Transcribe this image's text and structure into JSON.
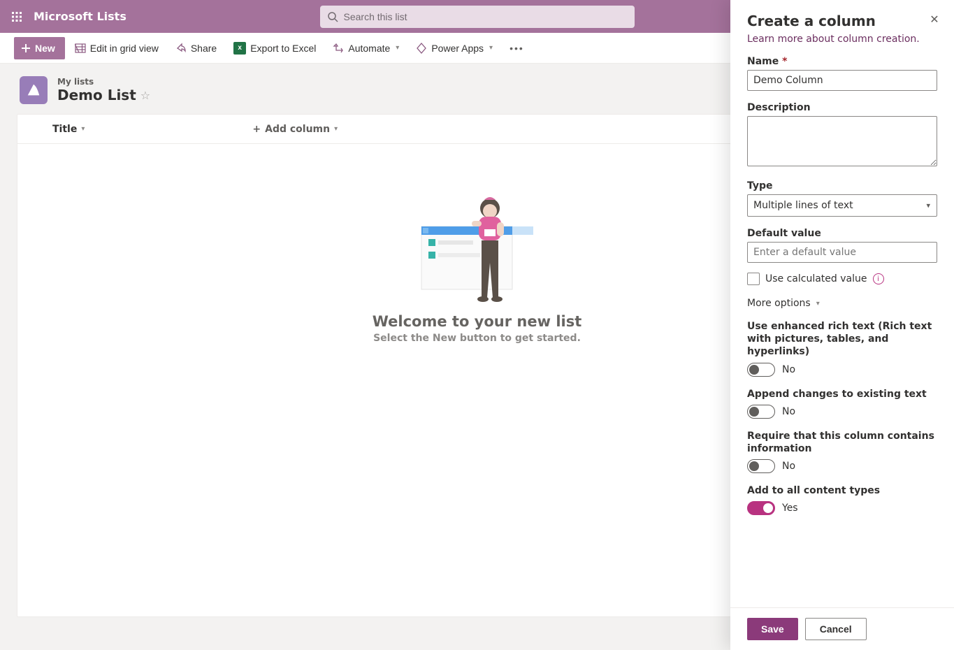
{
  "header": {
    "app_title": "Microsoft Lists",
    "search_placeholder": "Search this list"
  },
  "cmdbar": {
    "new": "New",
    "edit_grid": "Edit in grid view",
    "share": "Share",
    "export": "Export to Excel",
    "automate": "Automate",
    "powerapps": "Power Apps"
  },
  "list": {
    "breadcrumb": "My lists",
    "name": "Demo List",
    "columns": {
      "title": "Title",
      "add": "Add column"
    }
  },
  "empty": {
    "heading": "Welcome to your new list",
    "sub": "Select the New button to get started."
  },
  "panel": {
    "title": "Create a column",
    "learn_more": "Learn more about column creation.",
    "name_label": "Name",
    "name_value": "Demo Column",
    "description_label": "Description",
    "description_value": "",
    "type_label": "Type",
    "type_value": "Multiple lines of text",
    "default_label": "Default value",
    "default_placeholder": "Enter a default value",
    "default_value": "",
    "calc_label": "Use calculated value",
    "more_options": "More options",
    "opts": {
      "rich_text": {
        "label": "Use enhanced rich text (Rich text with pictures, tables, and hyperlinks)",
        "on": false,
        "state": "No"
      },
      "append": {
        "label": "Append changes to existing text",
        "on": false,
        "state": "No"
      },
      "required": {
        "label": "Require that this column contains information",
        "on": false,
        "state": "No"
      },
      "all_ct": {
        "label": "Add to all content types",
        "on": true,
        "state": "Yes"
      }
    },
    "save": "Save",
    "cancel": "Cancel"
  }
}
